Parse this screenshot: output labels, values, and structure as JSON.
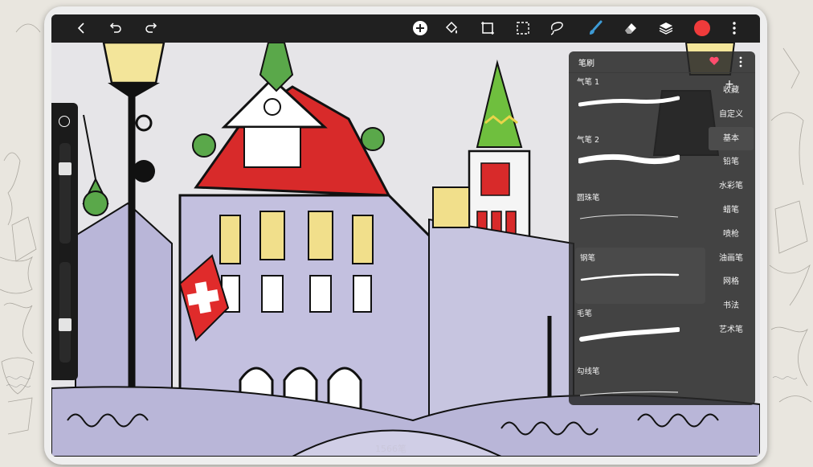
{
  "colors": {
    "accent_brush": "#3d9bd6",
    "current_color": "#ef3b3b",
    "heart": "#ff4d6d",
    "panel_bg": "#2b2b2b",
    "sketch_lavender": "#b9b6d8",
    "roof_red": "#d82a2a"
  },
  "topbar": {
    "icons_left": [
      "back-icon",
      "undo-icon",
      "redo-icon"
    ],
    "icons_right": [
      "add-icon",
      "fill-bucket-icon",
      "transform-icon",
      "selection-icon",
      "lasso-icon",
      "brush-icon",
      "eraser-icon",
      "layers-icon",
      "color-swatch",
      "more-icon"
    ],
    "active_tool": "brush-icon"
  },
  "sidebar": {
    "top_icon": "circle-icon",
    "size_slider_level": 0.2,
    "opacity_slider_level": 0.75
  },
  "status": {
    "stroke_count": "1566笔"
  },
  "brush_panel": {
    "title": "笔刷",
    "add_label": "+",
    "brushes": [
      {
        "name": "气笔 1",
        "selected": false
      },
      {
        "name": "气笔 2",
        "selected": false
      },
      {
        "name": "圆珠笔",
        "selected": false
      },
      {
        "name": "钢笔",
        "selected": true
      },
      {
        "name": "毛笔",
        "selected": false
      },
      {
        "name": "勾线笔",
        "selected": false
      }
    ],
    "categories": [
      "收藏",
      "自定义",
      "基本",
      "铅笔",
      "水彩笔",
      "蜡笔",
      "喷枪",
      "油画笔",
      "网格",
      "书法",
      "艺术笔"
    ],
    "active_category": "基本"
  }
}
